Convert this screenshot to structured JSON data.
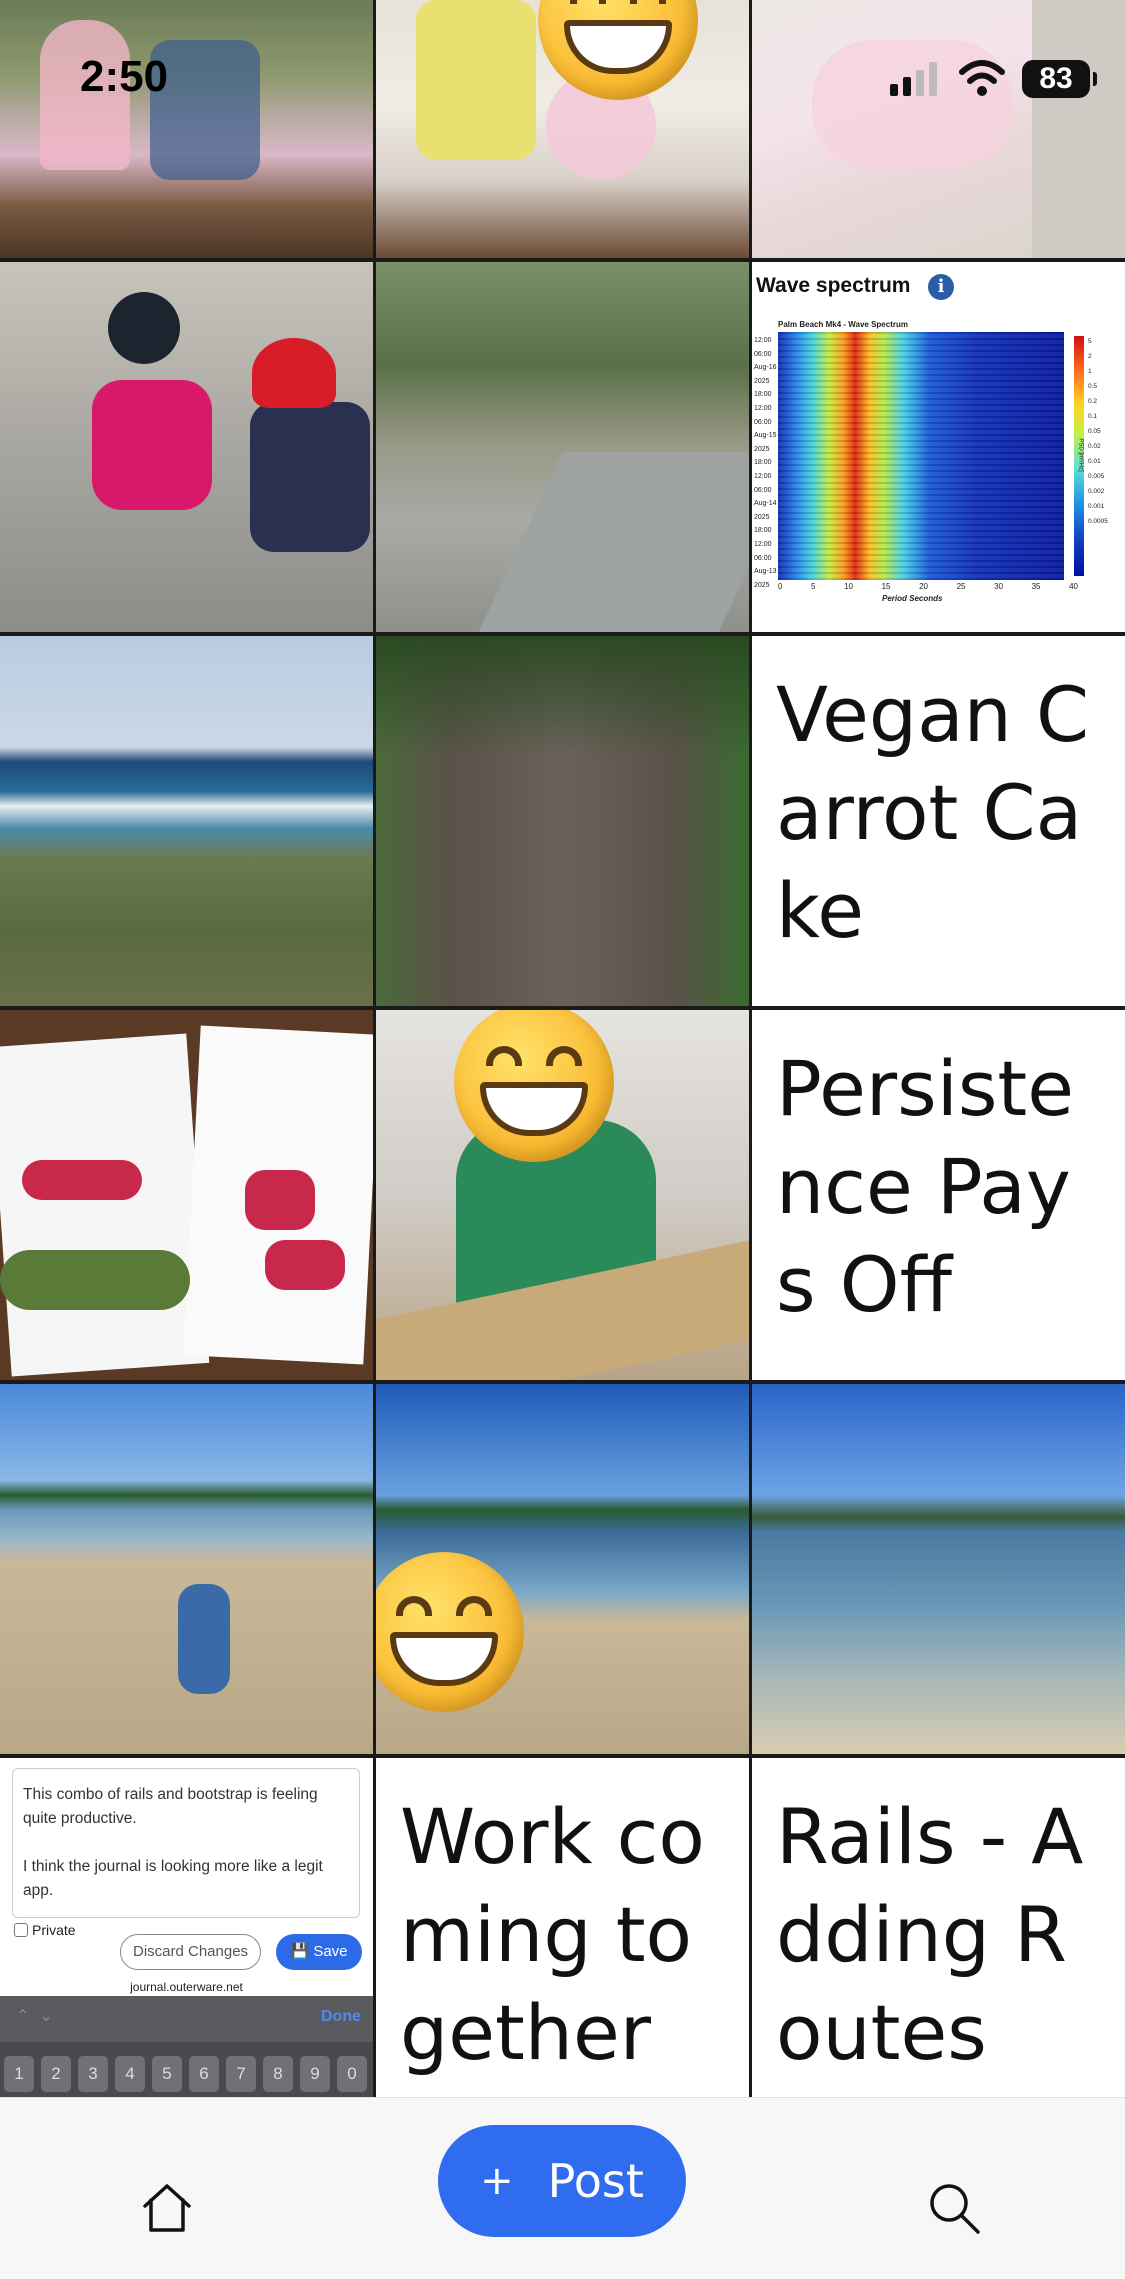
{
  "status_bar": {
    "time": "2:50",
    "battery": "83"
  },
  "tiles": {
    "wave": {
      "title": "Wave spectrum",
      "subtitle": "Palm Beach Mk4 - Wave Spectrum",
      "y_ticks": [
        "12:00",
        "06:00",
        "Aug-16 2025",
        "18:00",
        "12:00",
        "06:00",
        "Aug-15 2025",
        "18:00",
        "12:00",
        "06:00",
        "Aug-14 2025",
        "18:00",
        "12:00",
        "06:00",
        "Aug-13 2025"
      ],
      "x_ticks": [
        "0",
        "5",
        "10",
        "15",
        "20",
        "25",
        "30",
        "35",
        "40"
      ],
      "x_label": "Period Seconds",
      "color_ticks": [
        "5",
        "2",
        "1",
        "0.5",
        "0.2",
        "0.1",
        "0.05",
        "0.02",
        "0.01",
        "0.005",
        "0.002",
        "0.001",
        "0.0005"
      ],
      "color_unit": "PSD [m²/Hz]"
    },
    "vegan": {
      "title": "Vegan Carrot Cake"
    },
    "persistence": {
      "title": "Persistence Pays Off"
    },
    "journal": {
      "line1": "This combo of rails and bootstrap is feeling quite productive.",
      "line2": "I think the journal is looking more like a legit app.",
      "private_label": "Private",
      "discard_label": "Discard Changes",
      "save_label": "Save",
      "url": "journal.outerware.net",
      "done_label": "Done",
      "keys": [
        "1",
        "2",
        "3",
        "4",
        "5",
        "6",
        "7",
        "8",
        "9",
        "0"
      ]
    },
    "work": {
      "title": "Work coming together"
    },
    "rails": {
      "title": "Rails - Adding Routes"
    }
  },
  "bottom_nav": {
    "home_icon": "home-icon",
    "post_label": "Post",
    "search_icon": "search-icon",
    "accent": "#2f6cf0"
  }
}
